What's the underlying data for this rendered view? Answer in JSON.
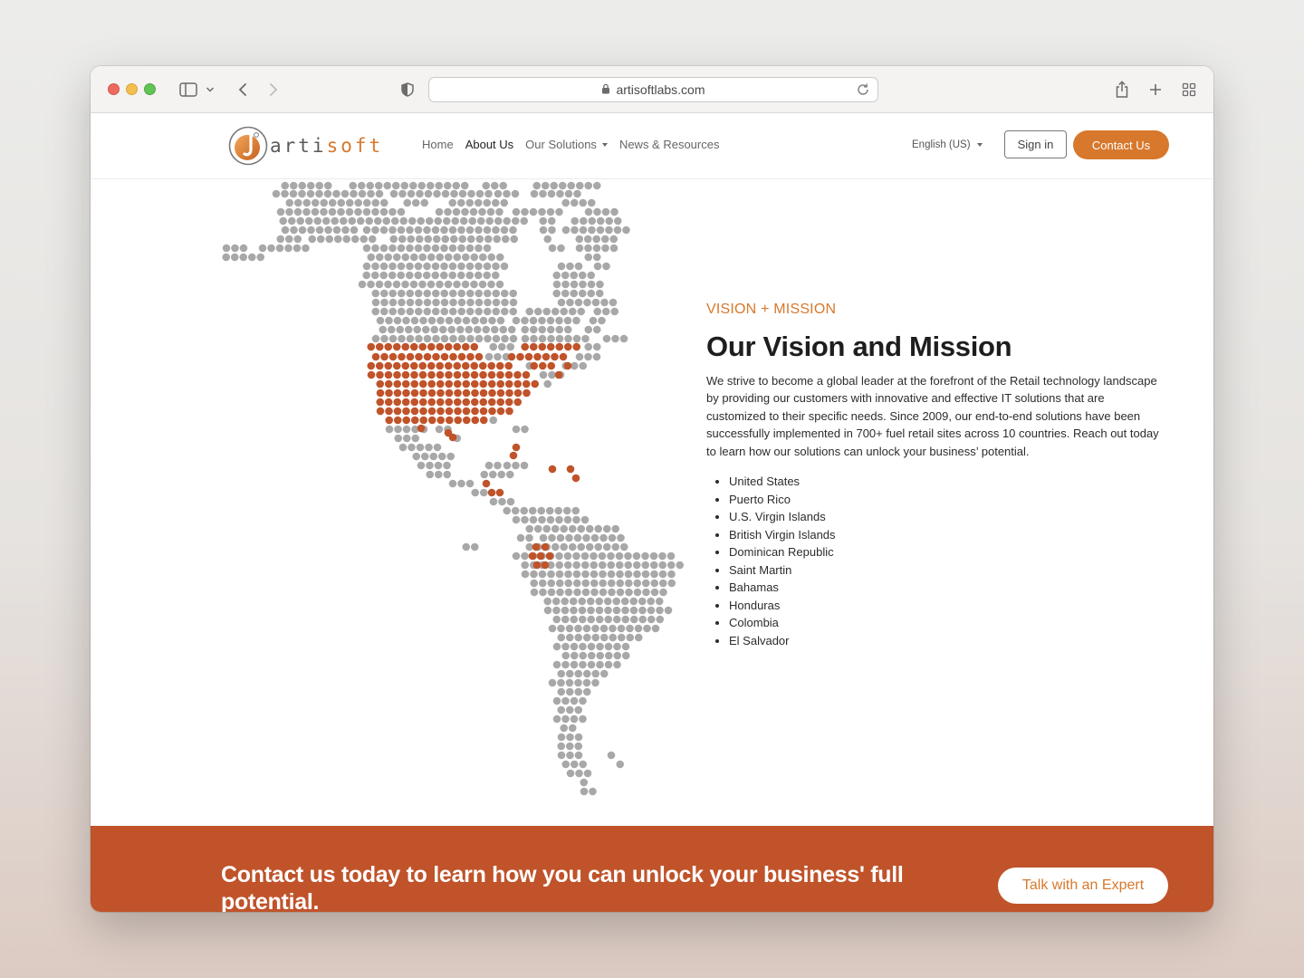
{
  "browser": {
    "url": "artisoftlabs.com",
    "icons": [
      "sidebar-icon",
      "chevron-down-icon",
      "back-icon",
      "forward-icon",
      "shield-icon",
      "lock-icon",
      "reload-icon",
      "share-icon",
      "plus-icon",
      "tab-grid-icon"
    ]
  },
  "nav": {
    "logo_text_1": "arti",
    "logo_text_2": "soft",
    "links": [
      {
        "label": "Home"
      },
      {
        "label": "About Us"
      },
      {
        "label": "Our Solutions"
      },
      {
        "label": "News & Resources"
      }
    ],
    "language": "English (US)",
    "sign_in": "Sign in",
    "contact": "Contact Us"
  },
  "section": {
    "eyebrow": "VISION + MISSION",
    "title": "Our Vision and Mission",
    "body": "We strive to become a global leader at the forefront of the Retail technology landscape by providing our customers with innovative and effective IT solutions that are customized to their specific needs. Since 2009, our end-to-end solutions have been successfully implemented in 700+ fuel retail sites across 10 countries. Reach out today to learn how our solutions can unlock your business’ potential.",
    "countries": [
      "United States",
      "Puerto Rico",
      "U.S. Virgin Islands",
      "British Virgin Islands",
      "Dominican Republic",
      "Saint Martin",
      "Bahamas",
      "Honduras",
      "Colombia",
      "El Salvador"
    ]
  },
  "cta": {
    "title": "Contact us today to learn how you can unlock your business' full potential.",
    "button": "Talk with an Expert"
  },
  "colors": {
    "brand_orange": "#d7782c",
    "map_highlight": "#c0532a",
    "map_dot": "#a8a8a8",
    "cta_background": "#c0532a"
  }
}
